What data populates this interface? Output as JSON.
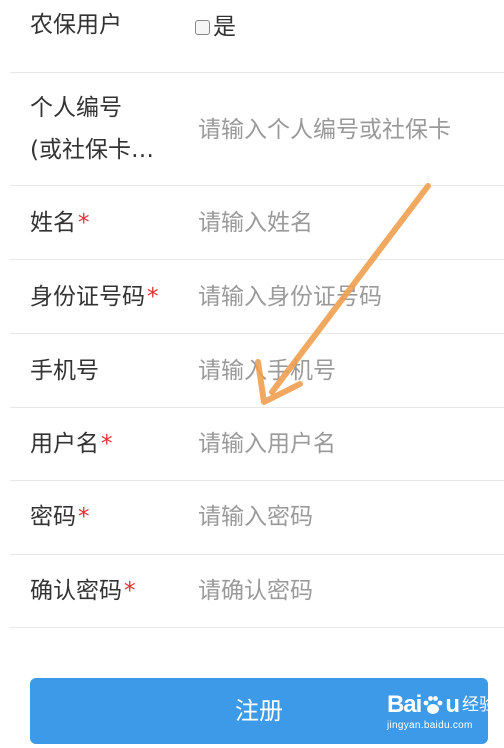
{
  "form": {
    "farm_insurance": {
      "label": "农保用户",
      "checkbox_label": "是"
    },
    "personal_id": {
      "label_line1": "个人编号",
      "label_line2": "(或社保卡…",
      "placeholder": "请输入个人编号或社保卡"
    },
    "name": {
      "label": "姓名",
      "required_mark": "*",
      "placeholder": "请输入姓名"
    },
    "id_number": {
      "label": "身份证号码",
      "required_mark": "*",
      "placeholder": "请输入身份证号码"
    },
    "phone": {
      "label": "手机号",
      "placeholder": "请输入手机号"
    },
    "username": {
      "label": "用户名",
      "required_mark": "*",
      "placeholder": "请输入用户名"
    },
    "password": {
      "label": "密码",
      "required_mark": "*",
      "placeholder": "请输入密码"
    },
    "confirm_password": {
      "label": "确认密码",
      "required_mark": "*",
      "placeholder": "请确认密码"
    }
  },
  "submit_label": "注册",
  "watermark": {
    "brand_left": "Bai",
    "brand_right": "u",
    "brand_cn": "经验",
    "url": "jingyan.baidu.com"
  },
  "colors": {
    "button": "#3d9ae8",
    "required": "#e23030",
    "placeholder": "#9a9a9a",
    "arrow": "#f0a050"
  }
}
